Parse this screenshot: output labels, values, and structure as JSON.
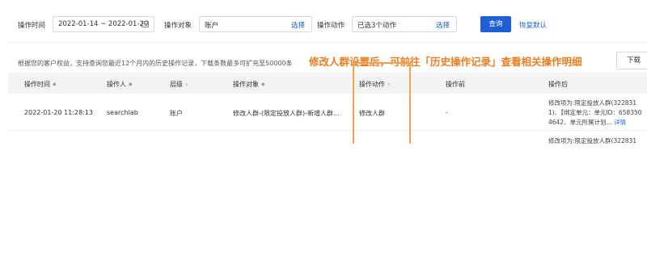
{
  "filters": {
    "time_label": "操作时间",
    "time_value": "2022-01-14 ~ 2022-01-20",
    "object_label": "操作对象",
    "object_value": "账户",
    "object_pick": "选择",
    "action_label": "操作动作",
    "action_value": "已选3个动作",
    "action_pick": "选择",
    "query_button": "查询",
    "reset_button": "恢复默认"
  },
  "notice": "根据您的客户权益，支持查询您最近12个月内的历史操作记录，下载条数最多可扩充至50000条",
  "callout": "修改人群设置后，可前往「历史操作记录」查看相关操作明细",
  "download_button": "下载",
  "table": {
    "headers": {
      "time": "操作时间",
      "operator": "操作人",
      "level": "层级",
      "object": "操作对象",
      "action": "操作动作",
      "before": "操作前",
      "after": "操作后"
    },
    "rows": [
      {
        "time": "2022-01-20 11:28:13",
        "operator": "searchlab",
        "level": "账户",
        "object": "修改人群-(限定投放人群)-新增人群...",
        "action": "修改人群",
        "before": "-",
        "after_lines": [
          "修改项为:限定投放人群(322831",
          "1)、【绑定单元：单元ID：658350",
          "4642、单元所属计划..."
        ],
        "after_detail": "详情"
      },
      {
        "after_lines": [
          "修改项为:限定投放人群(322831"
        ]
      }
    ]
  }
}
